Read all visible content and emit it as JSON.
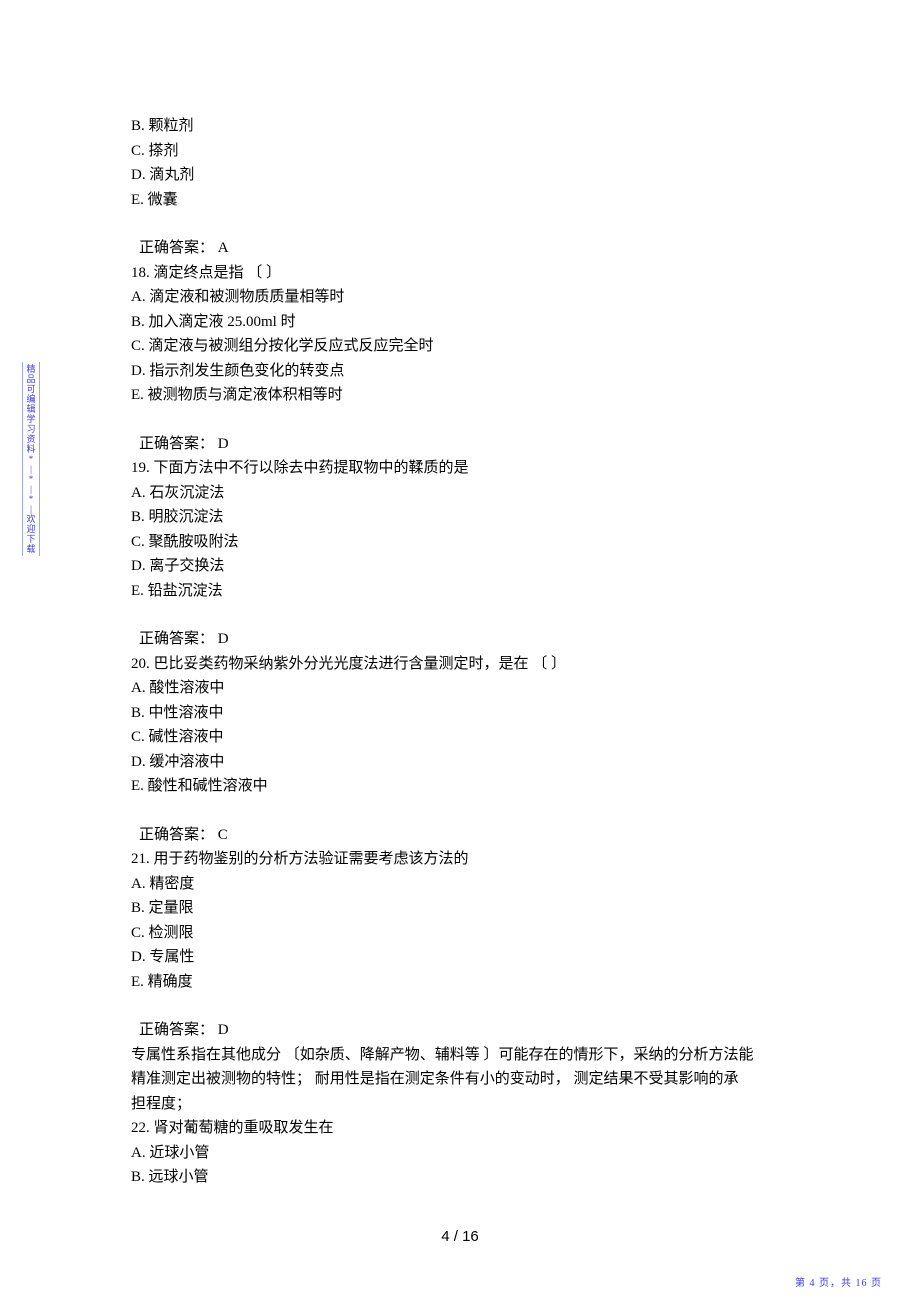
{
  "lead_options": {
    "b": "B.  颗粒剂",
    "c": "C.  搽剂",
    "d": "D.  滴丸剂",
    "e": "E.  微囊"
  },
  "a17": "正确答案：  A",
  "q18": {
    "stem": "18.  滴定终点是指   〔  〕",
    "a": "A.  滴定液和被测物质质量相等时",
    "b": "B.  加入滴定液   25.00ml 时",
    "c": "C.  滴定液与被测组分按化学反应式反应完全时",
    "d": "D.  指示剂发生颜色变化的转变点",
    "e": "E.  被测物质与滴定液体积相等时",
    "ans": "正确答案：  D"
  },
  "q19": {
    "stem": "19.  下面方法中不行以除去中药提取物中的鞣质的是",
    "a": "A.  石灰沉淀法",
    "b": "B.  明胶沉淀法",
    "c": "C.  聚酰胺吸附法",
    "d": "D.  离子交换法",
    "e": "E.  铅盐沉淀法",
    "ans": "正确答案：  D"
  },
  "q20": {
    "stem": "20.  巴比妥类药物采纳紫外分光光度法进行含量测定时，是在          〔  〕",
    "a": "A.  酸性溶液中",
    "b": "B.  中性溶液中",
    "c": "C.  碱性溶液中",
    "d": "D.  缓冲溶液中",
    "e": "E.  酸性和碱性溶液中",
    "ans": "正确答案：  C"
  },
  "q21": {
    "stem": "21.  用于药物鉴别的分析方法验证需要考虑该方法的",
    "a": "A.  精密度",
    "b": "B.  定量限",
    "c": "C.  检测限",
    "d": "D.  专属性",
    "e": "E.  精确度",
    "ans": "正确答案：  D",
    "exp1": "专属性系指在其他成分    〔如杂质、降解产物、辅料等  〕可能存在的情形下，采纳的分析方法能",
    "exp2": "精准测定出被测物的特性；   耐用性是指在测定条件有小的变动时，     测定结果不受其影响的承",
    "exp3": "担程度；"
  },
  "q22": {
    "stem": "22.  肾对葡萄糖的重吸取发生在",
    "a": "A.  近球小管",
    "b": "B.  远球小管"
  },
  "pagenum": "4  /  16",
  "sidebar": [
    "精",
    "品",
    "可",
    "编",
    "辑",
    "学",
    "习",
    "资",
    "料",
    "*",
    "|",
    "*",
    "|",
    "*",
    "|",
    "欢",
    "迎",
    "下",
    "载"
  ],
  "footer": "第 4 页，共 16 页"
}
